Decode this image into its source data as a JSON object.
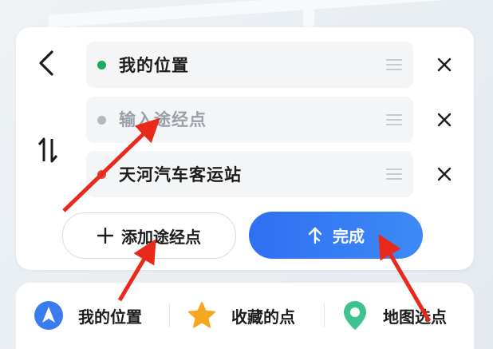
{
  "route": {
    "stops": [
      {
        "label": "我的位置",
        "dot_color": "#1aab5c"
      },
      {
        "placeholder": "输入途经点",
        "value": "",
        "dot_color": "#b4b8bf"
      },
      {
        "label": "天河汽车客运站",
        "dot_color": "#e04a3a"
      }
    ],
    "add_stop_label": "添加途经点",
    "done_label": "完成"
  },
  "bottom_bar": {
    "items": [
      {
        "label": "我的位置",
        "icon": "navigation-arrow-icon",
        "icon_color": "#3a7cf0"
      },
      {
        "label": "收藏的点",
        "icon": "star-icon",
        "icon_color": "#f5a623"
      },
      {
        "label": "地图选点",
        "icon": "map-pin-icon",
        "icon_color": "#3ec28f"
      }
    ]
  },
  "colors": {
    "accent": "#2f6ff2",
    "annotation_arrow": "#e8291c"
  }
}
